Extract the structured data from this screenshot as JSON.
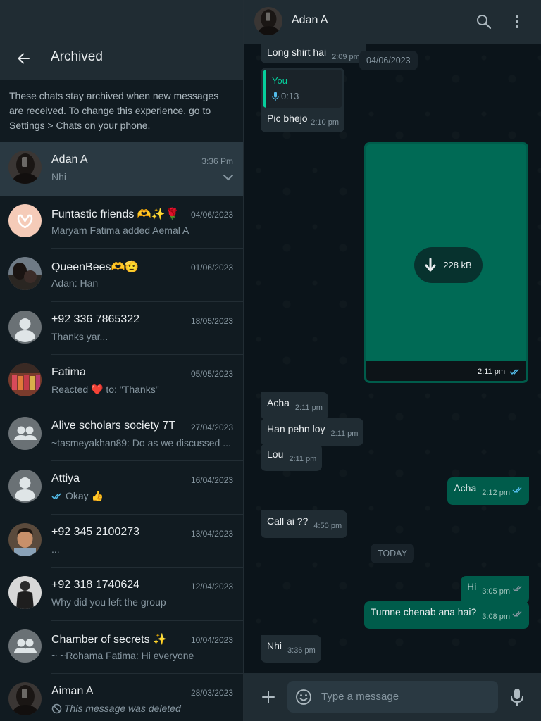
{
  "left_panel": {
    "title": "Archived",
    "back_icon": "arrow-left-icon",
    "info_text": "These chats stay archived when new messages are received. To change this experience, go to Settings > Chats on your phone.",
    "chats": [
      {
        "name": "Adan A",
        "time": "3:36 Pm",
        "preview": "Nhi",
        "avatar": "photo-dark",
        "active": true
      },
      {
        "name": "Funtastic friends 🫶✨🌹",
        "time": "04/06/2023",
        "preview": "Maryam Fatima added Aemal A",
        "avatar": "hands-heart"
      },
      {
        "name": "QueenBees🫶🫡",
        "time": "01/06/2023",
        "preview": "Adan: Han",
        "avatar": "photo-scenery"
      },
      {
        "name": "+92 336 7865322",
        "time": "18/05/2023",
        "preview": "Thanks yar...",
        "avatar": "default-user"
      },
      {
        "name": "Fatima",
        "time": "05/05/2023",
        "preview": "Reacted ❤️ to: \"Thanks\"",
        "avatar": "photo-group"
      },
      {
        "name": "Alive scholars society 7T",
        "time": "27/04/2023",
        "preview": "~tasmeyakhan89: Do as we discussed ...",
        "avatar": "default-group"
      },
      {
        "name": "Attiya",
        "time": "16/04/2023",
        "preview": "Okay 👍",
        "avatar": "default-user",
        "read_ticks": true
      },
      {
        "name": "+92 345 2100273",
        "time": "13/04/2023",
        "preview": "...",
        "avatar": "photo-child"
      },
      {
        "name": "+92 318 1740624",
        "time": "12/04/2023",
        "preview": "Why did you left the group",
        "avatar": "photo-person"
      },
      {
        "name": "Chamber of secrets ✨",
        "time": "10/04/2023",
        "preview": "~ ~Rohama Fatima: Hi everyone",
        "avatar": "default-group"
      },
      {
        "name": "Aiman A",
        "time": "28/03/2023",
        "preview": "This message was deleted",
        "avatar": "photo-dark",
        "deleted": true
      }
    ]
  },
  "chat": {
    "contact_name": "Adan A",
    "search_icon": "search-icon",
    "menu_icon": "more-vertical-icon",
    "messages": {
      "m1_text": "Long shirt hai",
      "m1_time": "2:09 pm",
      "date1": "04/06/2023",
      "quote_author": "You",
      "quote_voice": "0:13",
      "m2_text": "Pic bhejo",
      "m2_time": "2:10 pm",
      "image_size": "228 kB",
      "image_time": "2:11 pm",
      "m3_text": "Acha",
      "m3_time": "2:11 pm",
      "m4_text": "Han pehn loy",
      "m4_time": "2:11 pm",
      "m5_text": "Lou",
      "m5_time": "2:11 pm",
      "m6_text": "Acha",
      "m6_time": "2:12 pm",
      "m7_text": "Call ai ??",
      "m7_time": "4:50 pm",
      "date2": "TODAY",
      "m8_text": "Hi",
      "m8_time": "3:05 pm",
      "m9_text": "Tumne chenab ana hai?",
      "m9_time": "3:08 pm",
      "m10_text": "Nhi",
      "m10_time": "3:36 pm"
    },
    "composer": {
      "placeholder": "Type a message",
      "attach_icon": "plus-icon",
      "emoji_icon": "emoji-icon",
      "mic_icon": "microphone-icon"
    }
  },
  "colors": {
    "panel_bg": "#111b21",
    "header_bg": "#202c33",
    "incoming_bubble": "#202c33",
    "outgoing_bubble": "#005c4b",
    "accent": "#06cf9c",
    "read_tick": "#53bdeb"
  }
}
